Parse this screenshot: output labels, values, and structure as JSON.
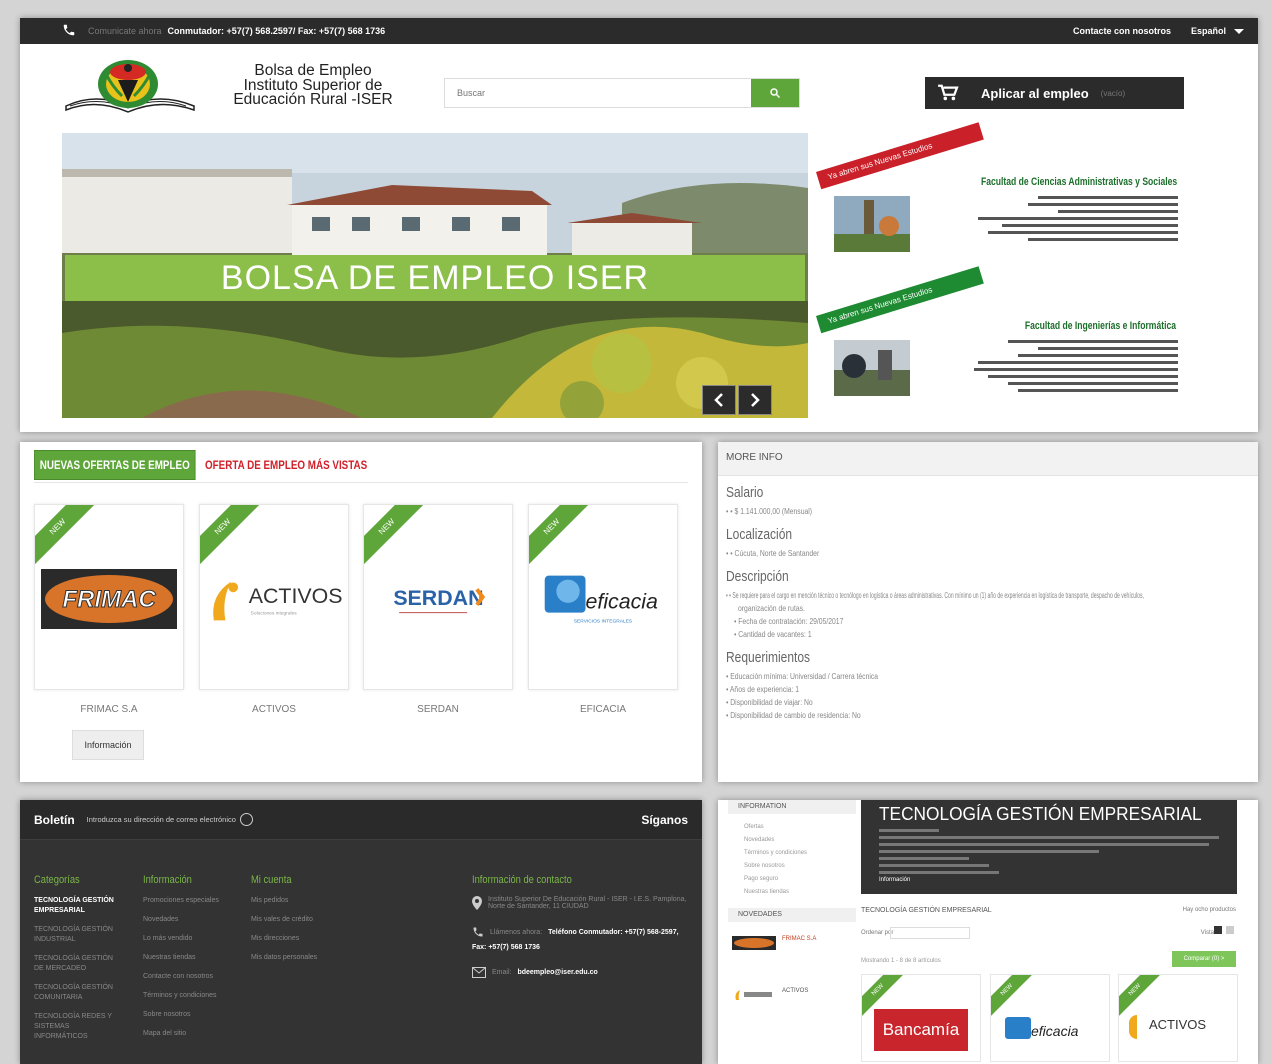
{
  "topbar": {
    "faded": "Comunicate ahora",
    "phones": "Conmutador: +57(7) 568.2597/ Fax: +57(7) 568 1736",
    "contact": "Contacte con nosotros",
    "language": "Español"
  },
  "header": {
    "logo_line1": "Bolsa de Empleo",
    "logo_line2": "Instituto Superior de",
    "logo_line3": "Educación Rural -ISER",
    "search_placeholder": "Buscar",
    "apply_label": "Aplicar al empleo",
    "apply_muted": "(vacío)"
  },
  "slider": {
    "caption": "BOLSA DE EMPLEO ISER"
  },
  "promos": [
    {
      "ribbon": "Ya abren sus Nuevas Estudios",
      "title": "Facultad de Ciencias Administrativas y Sociales",
      "color": "#c9202a"
    },
    {
      "ribbon": "Ya abren sus Nuevas Estudios",
      "title": "Facultad de Ingenierías e Informática",
      "color": "#1e8a32"
    }
  ],
  "offers": {
    "tab_new": "NUEVAS OFERTAS DE EMPLEO",
    "tab_most": "OFERTA DE EMPLEO MÁS VISTAS",
    "badge": "NEW",
    "info_button": "Información",
    "cards": [
      {
        "name": "FRIMAC S.A",
        "logo": "FRIMAC"
      },
      {
        "name": "ACTIVOS",
        "logo": "ACTIVOS"
      },
      {
        "name": "SERDAN",
        "logo": "SERDAN"
      },
      {
        "name": "EFICACIA",
        "logo": "eficacia"
      }
    ],
    "activos_tag": "Soluciones integrales",
    "eficacia_tag": "SERVICIOS INTEGRALES"
  },
  "more_info": {
    "title": "MORE INFO",
    "salary_h": "Salario",
    "salary": "• • $ 1.141.000,00 (Mensual)",
    "location_h": "Localización",
    "location": "• • Cúcuta, Norte de Santander",
    "description_h": "Descripción",
    "desc1": "• • Se requiere para el cargo en mención técnico o tecnólogo en logística o áreas administrativas. Con mínimo un (1) año de experiencia en logística de transporte, despacho de vehículos,",
    "desc2": "organización de rutas.",
    "desc3": "• Fecha de contratación: 29/05/2017",
    "desc4": "• Cantidad de vacantes: 1",
    "req_h": "Requerimientos",
    "req1": "• Educación mínima: Universidad / Carrera técnica",
    "req2": "• Años de experiencia: 1",
    "req3": "• Disponibilidad de viajar: No",
    "req4": "• Disponibilidad de cambio de residencia: No"
  },
  "footer": {
    "boletin": "Boletín",
    "newsletter": "Introduzca su dirección de correo electrónico",
    "siganos": "Síganos",
    "categorias_h": "Categorías",
    "categorias": [
      "TECNOLOGÍA GESTIÓN EMPRESARIAL",
      "TECNOLOGÍA GESTIÓN INDUSTRIAL",
      "TECNOLOGÍA GESTIÓN DE MERCADEO",
      "TECNOLOGÍA GESTIÓN COMUNITARIA",
      "TECNOLOGÍA REDES Y SISTEMAS INFORMÁTICOS"
    ],
    "informacion_h": "Información",
    "informacion": [
      "Promociones especiales",
      "Novedades",
      "Lo más vendido",
      "Nuestras tiendas",
      "Contacte con nosotros",
      "Términos y condiciones",
      "Sobre nosotros",
      "Mapa del sitio"
    ],
    "cuenta_h": "Mi cuenta",
    "cuenta": [
      "Mis pedidos",
      "Mis vales de crédito",
      "Mis direcciones",
      "Mis datos personales"
    ],
    "contacto_h": "Información de contacto",
    "address": "Instituto Superior De Educación Rural - ISER - I.E.S. Pamplona, Norte de Santander, 11 CIUDAD",
    "phone_muted": "Llámenos ahora:",
    "phone": "Teléfono Conmutador: +57(7) 568-2597,",
    "fax": "Fax: +57(7) 568 1736",
    "email_muted": "Email:",
    "email": "bdeempleo@iser.edu.co"
  },
  "category": {
    "side_info": "INFORMATION",
    "side_items": [
      "Ofertas",
      "Novedades",
      "Términos y condiciones",
      "Sobre nosotros",
      "Pago seguro",
      "Nuestras tiendas"
    ],
    "side_news": "NOVEDADES",
    "news": [
      {
        "name": "FRIMAC S.A"
      },
      {
        "name": "ACTIVOS"
      }
    ],
    "banner_title": "TECNOLOGÍA GESTIÓN EMPRESARIAL",
    "banner_info": "Información",
    "crumb": "TECNOLOGÍA GESTIÓN EMPRESARIAL",
    "products_count": "Hay ocho productos",
    "sort": "Ordenar por",
    "view": "Vista",
    "compare": "Comparar (0) >",
    "showing": "Mostrando 1 - 8 de 8 artículos",
    "cards": [
      "Bancamía",
      "eficacia",
      "ACTIVOS"
    ]
  },
  "colors": {
    "accent_green": "#5fa63a",
    "dark": "#2b2b2b",
    "red": "#d02028"
  }
}
